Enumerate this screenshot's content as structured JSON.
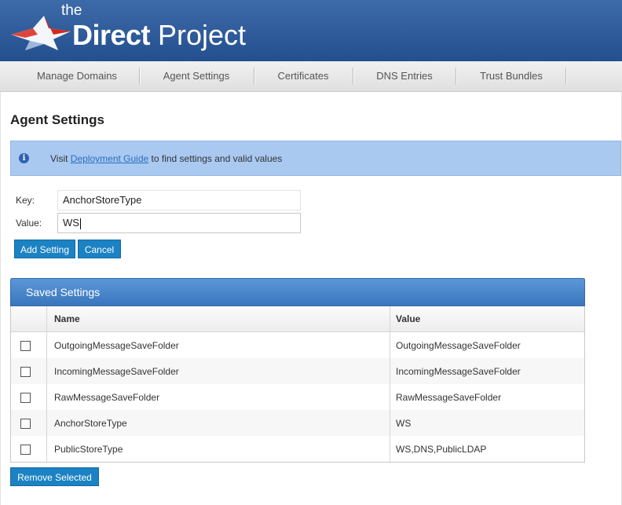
{
  "header": {
    "logo_the": "the",
    "logo_direct": "Direct",
    "logo_project": "Project"
  },
  "nav": {
    "items": [
      "Manage Domains",
      "Agent Settings",
      "Certificates",
      "DNS Entries",
      "Trust Bundles"
    ]
  },
  "page_title": "Agent Settings",
  "info": {
    "icon": "info-icon",
    "prefix": "Visit",
    "link": "Deployment Guide",
    "suffix": "to find settings and valid values"
  },
  "form": {
    "key_label": "Key:",
    "key_value": "AnchorStoreType",
    "value_label": "Value:",
    "value_value": "WS",
    "add_button": "Add Setting",
    "cancel_button": "Cancel"
  },
  "saved": {
    "title": "Saved Settings",
    "columns": [
      "Name",
      "Value"
    ],
    "rows": [
      {
        "name": "OutgoingMessageSaveFolder",
        "value": "OutgoingMessageSaveFolder"
      },
      {
        "name": "IncomingMessageSaveFolder",
        "value": "IncomingMessageSaveFolder"
      },
      {
        "name": "RawMessageSaveFolder",
        "value": "RawMessageSaveFolder"
      },
      {
        "name": "AnchorStoreType",
        "value": "WS"
      },
      {
        "name": "PublicStoreType",
        "value": "WS,DNS,PublicLDAP"
      }
    ],
    "remove_button": "Remove Selected"
  },
  "colors": {
    "header_blue": "#244f8e",
    "button_blue": "#1b82c3",
    "info_bg": "#a9c9f1",
    "panel_blue": "#3a76bd"
  }
}
